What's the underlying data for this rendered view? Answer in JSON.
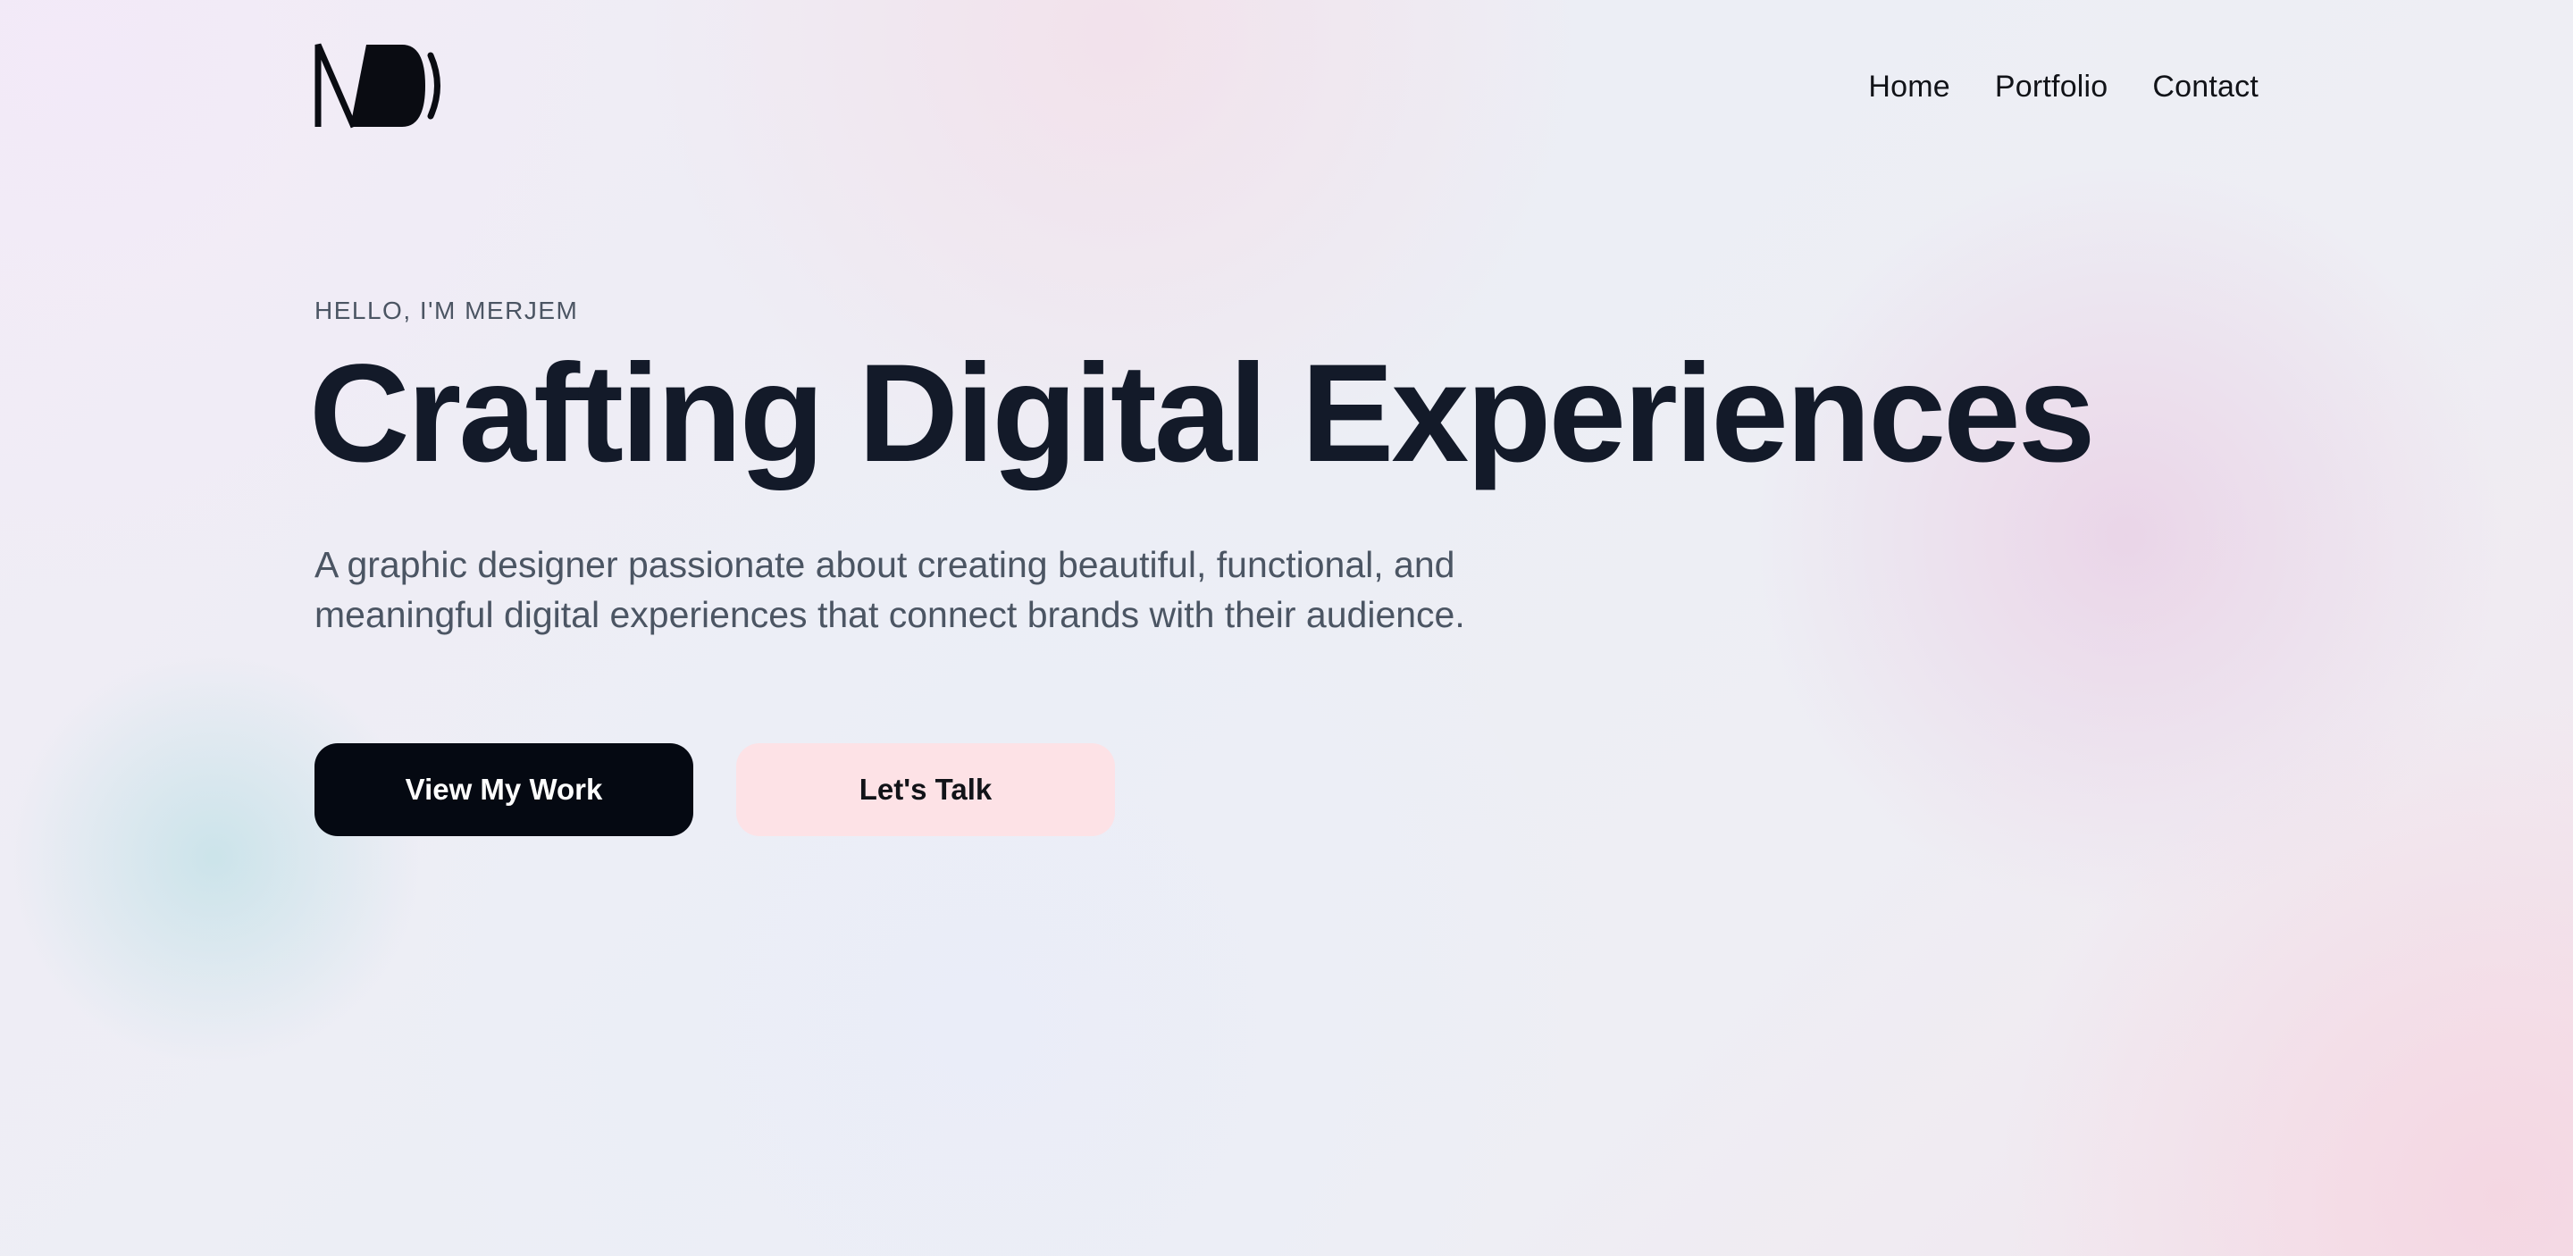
{
  "brand": {
    "logo_icon": "md-monogram-logo"
  },
  "nav": {
    "items": [
      {
        "label": "Home"
      },
      {
        "label": "Portfolio"
      },
      {
        "label": "Contact"
      }
    ]
  },
  "hero": {
    "eyebrow": "HELLO, I'M MERJEM",
    "title_part1": "Crafting Digital ",
    "title_highlight": "Experiences",
    "subtitle_line1": "A graphic designer passionate about creating beautiful, functional, and",
    "subtitle_line2": "meaningful digital experiences that connect brands with their audience.",
    "primary_button": "View My Work",
    "secondary_button": "Let's Talk"
  },
  "colors": {
    "text_dark": "#131a29",
    "text_muted": "#4b5563",
    "primary_button_bg": "#050912",
    "secondary_button_bg": "#fde2e6",
    "highlight": "#fbccd6"
  }
}
